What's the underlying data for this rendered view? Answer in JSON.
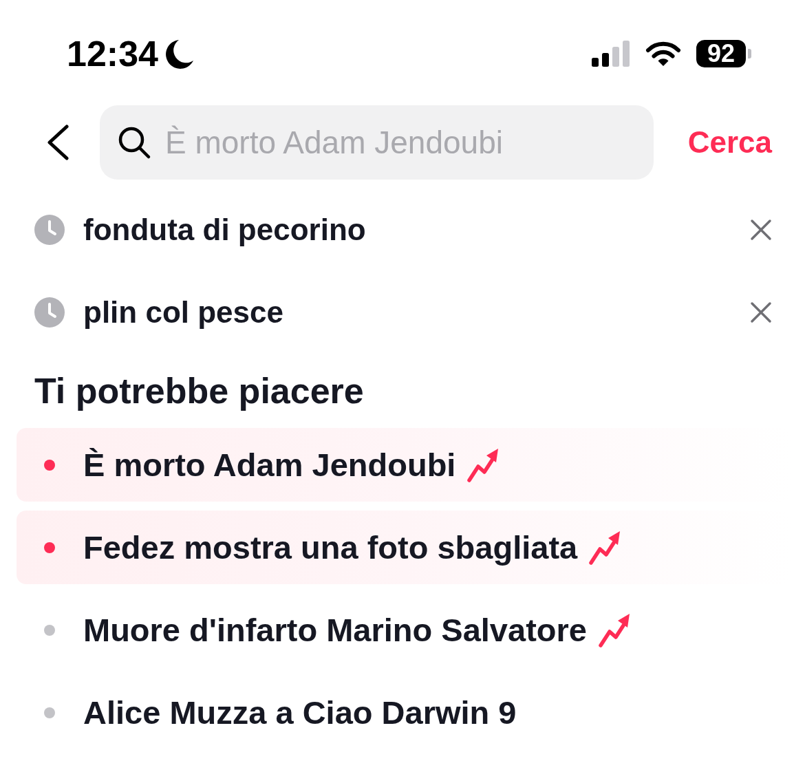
{
  "status_bar": {
    "time": "12:34",
    "battery": "92"
  },
  "search": {
    "placeholder": "È morto Adam Jendoubi",
    "submit": "Cerca"
  },
  "history": [
    {
      "text": "fonduta di pecorino"
    },
    {
      "text": "plin col pesce"
    }
  ],
  "suggestions_title": "Ti potrebbe piacere",
  "suggestions": [
    {
      "text": "È morto Adam Jendoubi",
      "highlighted": true,
      "color": "#fe2c55",
      "trending": true
    },
    {
      "text": "Fedez mostra una foto sbagliata",
      "highlighted": true,
      "color": "#fe2c55",
      "trending": true
    },
    {
      "text": "Muore d'infarto Marino Salvatore",
      "highlighted": false,
      "color": "#c3c3c7",
      "trending": true
    },
    {
      "text": "Alice Muzza a Ciao Darwin 9",
      "highlighted": false,
      "color": "#c3c3c7",
      "trending": false
    }
  ]
}
